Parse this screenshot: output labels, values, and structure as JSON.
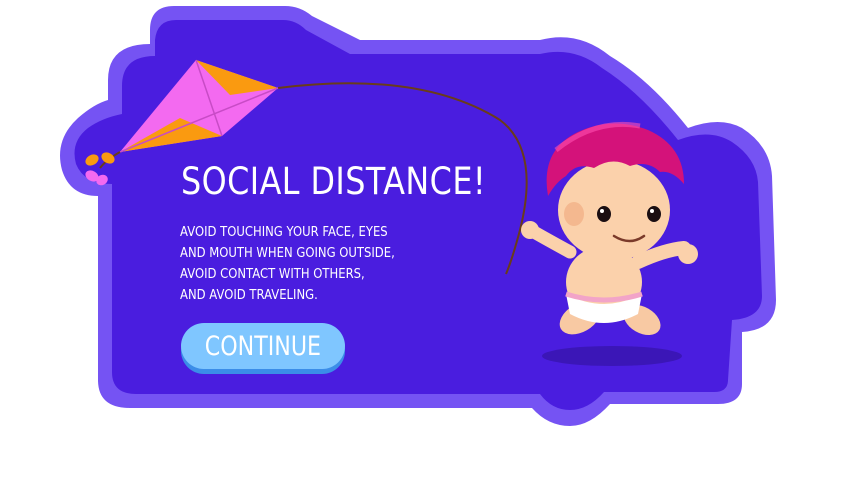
{
  "dialog": {
    "title": "SOCIAL DISTANCE!",
    "message_lines": [
      "AVOID TOUCHING YOUR FACE, EYES",
      "AND MOUTH WHEN GOING OUTSIDE,",
      "AVOID CONTACT WITH OTHERS,",
      "AND AVOID TRAVELING."
    ],
    "continue_label": "CONTINUE"
  },
  "colors": {
    "panel_fill": "#4a1ddf",
    "panel_rim": "#7553f3",
    "button_fill": "#7fc6ff",
    "button_shadow": "#3b8de8",
    "text": "#ffffff",
    "kite_pink": "#f36af0",
    "kite_orange": "#fa9a10",
    "hair": "#d4127a"
  },
  "icons": [
    "kite-icon",
    "baby-character-icon"
  ]
}
